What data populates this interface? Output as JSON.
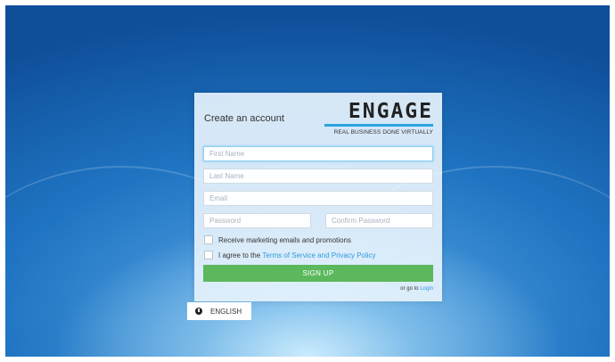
{
  "card": {
    "title": "Create an account",
    "logo": {
      "wordmark": "ENGAGE",
      "tagline": "REAL BUSINESS DONE VIRTUALLY",
      "accent": "#2aa3e0"
    }
  },
  "form": {
    "first_name_placeholder": "First Name",
    "last_name_placeholder": "Last Name",
    "email_placeholder": "Email",
    "password_placeholder": "Password",
    "confirm_password_placeholder": "Confirm Password",
    "marketing_label": "Receive marketing emails and promotions",
    "agree_prefix": "I agree to the ",
    "agree_link": "Terms of Service and Privacy Policy",
    "signup_label": "SIGN UP",
    "login_prefix": "or go to ",
    "login_link": "Login",
    "signup_color": "#5cb85c"
  },
  "language": {
    "icon": "globe-icon",
    "label": "ENGLISH"
  }
}
